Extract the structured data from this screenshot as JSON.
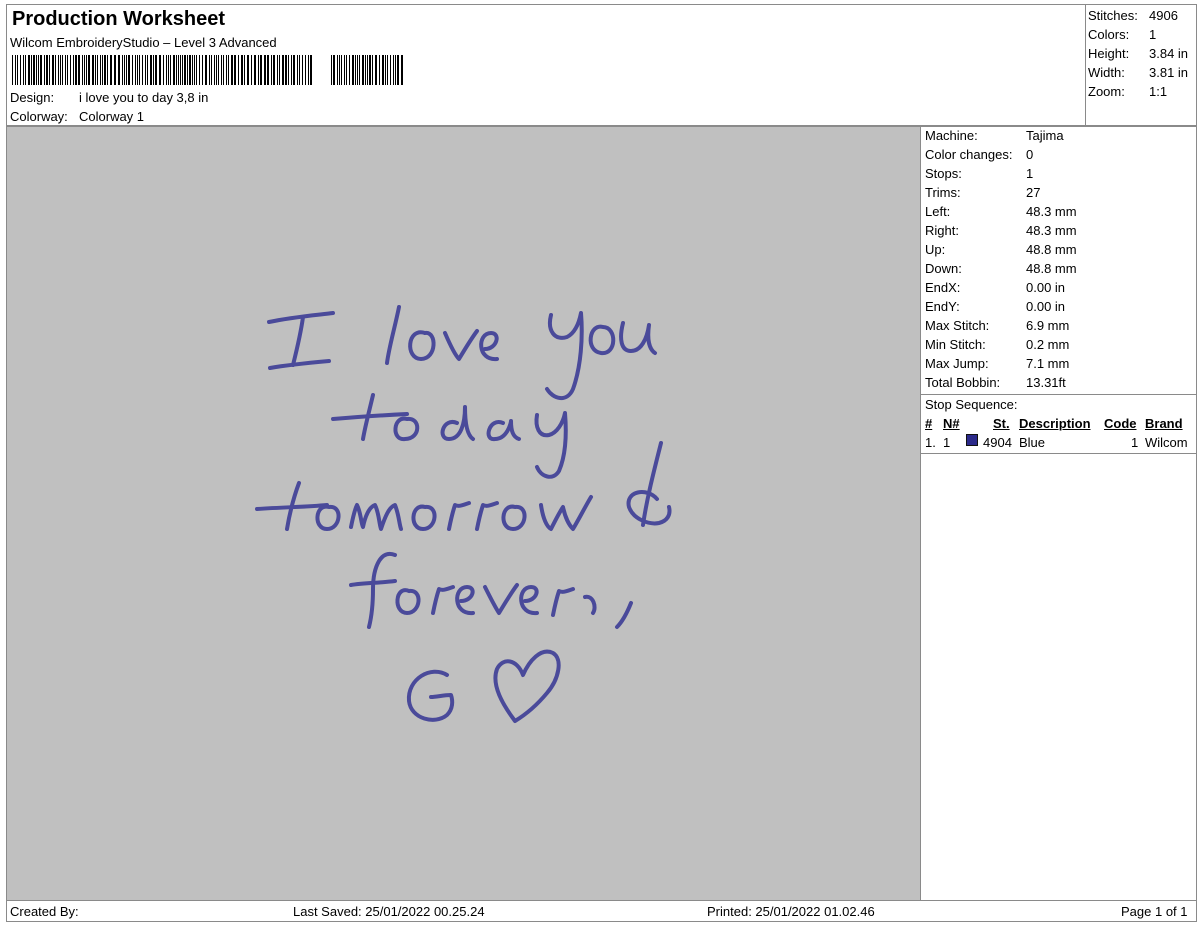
{
  "header": {
    "title": "Production Worksheet",
    "subtitle": "Wilcom EmbroideryStudio – Level 3 Advanced",
    "design_label": "Design:",
    "design_value": "i love you to day 3,8 in",
    "colorway_label": "Colorway:",
    "colorway_value": "Colorway 1"
  },
  "stats": [
    {
      "label": "Stitches:",
      "value": "4906"
    },
    {
      "label": "Colors:",
      "value": "1"
    },
    {
      "label": "Height:",
      "value": "3.84 in"
    },
    {
      "label": "Width:",
      "value": "3.81 in"
    },
    {
      "label": "Zoom:",
      "value": "1:1"
    }
  ],
  "machine_info": [
    {
      "label": "Machine:",
      "value": "Tajima"
    },
    {
      "label": "Color changes:",
      "value": "0"
    },
    {
      "label": "Stops:",
      "value": "1"
    },
    {
      "label": "Trims:",
      "value": "27"
    },
    {
      "label": "Left:",
      "value": "48.3 mm"
    },
    {
      "label": "Right:",
      "value": "48.3 mm"
    },
    {
      "label": "Up:",
      "value": "48.8 mm"
    },
    {
      "label": "Down:",
      "value": "48.8 mm"
    },
    {
      "label": "EndX:",
      "value": "0.00 in"
    },
    {
      "label": "EndY:",
      "value": "0.00 in"
    },
    {
      "label": "Max Stitch:",
      "value": "6.9 mm"
    },
    {
      "label": "Min Stitch:",
      "value": "0.2 mm"
    },
    {
      "label": "Max Jump:",
      "value": "7.1 mm"
    },
    {
      "label": "Total Bobbin:",
      "value": "13.31ft"
    }
  ],
  "stop_sequence": {
    "label": "Stop Sequence:",
    "columns": {
      "num": "#",
      "n": "N#",
      "st": "St.",
      "desc": "Description",
      "code": "Code",
      "brand": "Brand"
    },
    "rows": [
      {
        "num": "1.",
        "n": "1",
        "st": "4904",
        "desc": "Blue",
        "code": "1",
        "brand": "Wilcom",
        "color": "#2b2a8a"
      }
    ]
  },
  "footer": {
    "created_by": "Created By:",
    "last_saved": "Last Saved: 25/01/2022 00.25.24",
    "printed": "Printed: 25/01/2022 01.02.46",
    "page": "Page 1 of 1"
  },
  "design_colors": {
    "thread": "#4a4a9a",
    "background": "#c0c0c0"
  }
}
